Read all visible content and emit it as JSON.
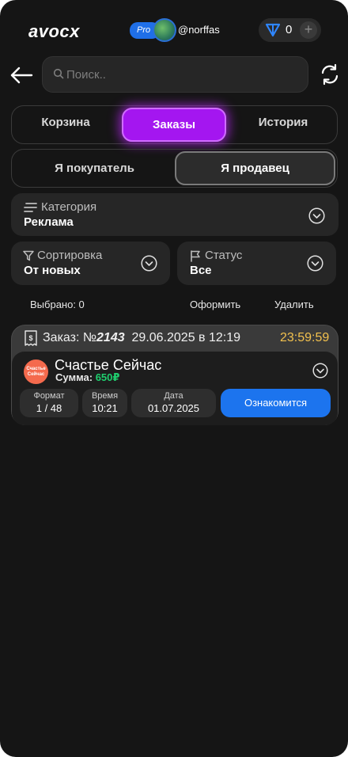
{
  "header": {
    "logo": "avocx",
    "pro_badge": "Pro",
    "username": "@norffas",
    "wallet_count": "0",
    "wallet_plus": "+"
  },
  "search": {
    "placeholder": "Поиск.."
  },
  "tabs": [
    {
      "label": "Корзина",
      "active": false
    },
    {
      "label": "Заказы",
      "active": true
    },
    {
      "label": "История",
      "active": false
    }
  ],
  "roles": [
    {
      "label": "Я покупатель",
      "active": false
    },
    {
      "label": "Я продавец",
      "active": true
    }
  ],
  "filters": {
    "category": {
      "title": "Категория",
      "value": "Реклама"
    },
    "sort": {
      "title": "Сортировка",
      "value": "От новых"
    },
    "status": {
      "title": "Статус",
      "value": "Все"
    }
  },
  "actions": {
    "selected": "Выбрано: 0",
    "checkout": "Оформить",
    "delete": "Удалить"
  },
  "order": {
    "title_prefix": "Заказ: №",
    "number": "2143",
    "datetime": "29.06.2025 в 12:19",
    "timer": "23:59:59",
    "shop_logo_text": "Счастье Сейчас",
    "shop_name": "Счастье Сейчас",
    "sum_label": "Сумма:",
    "sum_value": "650₽",
    "format_title": "Формат",
    "format_value": "1 / 48",
    "time_title": "Время",
    "time_value": "10:21",
    "date_title": "Дата",
    "date_value": "01.07.2025",
    "open_button": "Ознакомится"
  },
  "colors": {
    "accent_purple": "#a416f0",
    "primary_blue": "#1c74ee",
    "timer_yellow": "#f2c14e",
    "sum_green": "#1fd06f",
    "background": "#151515"
  },
  "icons": [
    "back-arrow-icon",
    "search-icon",
    "refresh-icon",
    "wallet-icon",
    "plus-icon",
    "lines-icon",
    "filter-icon",
    "flag-icon",
    "receipt-icon",
    "chevron-down-icon"
  ]
}
